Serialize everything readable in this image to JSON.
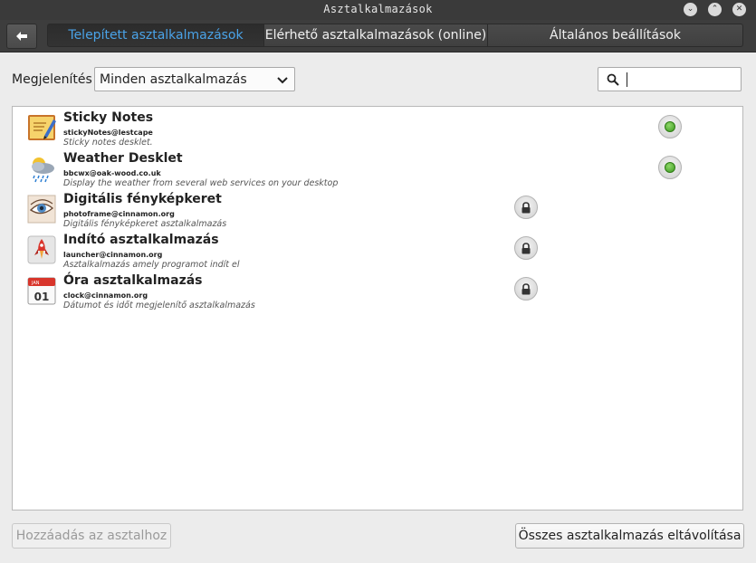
{
  "window": {
    "title": "Asztalkalmazások"
  },
  "toolbar": {
    "tabs": [
      {
        "label": "Telepített asztalkalmazások",
        "active": true
      },
      {
        "label": "Elérhető asztalkalmazások (online)",
        "active": false
      },
      {
        "label": "Általános beállítások",
        "active": false
      }
    ]
  },
  "filter": {
    "label": "Megjelenítés",
    "selected": "Minden asztalkalmazás",
    "search_value": ""
  },
  "desklets": [
    {
      "name": "Sticky Notes",
      "uuid": "stickyNotes@lestcape",
      "description": "Sticky notes desklet.",
      "status": "enabled",
      "icon": "sticky-notes-icon"
    },
    {
      "name": "Weather Desklet",
      "uuid": "bbcwx@oak-wood.co.uk",
      "description": "Display the weather from several web services on your desktop",
      "status": "enabled",
      "icon": "weather-icon"
    },
    {
      "name": "Digitális fényképkeret",
      "uuid": "photoframe@cinnamon.org",
      "description": "Digitális fényképkeret asztalkalmazás",
      "status": "locked",
      "icon": "photo-frame-icon"
    },
    {
      "name": "Indító asztalkalmazás",
      "uuid": "launcher@cinnamon.org",
      "description": "Asztalkalmazás amely programot indít el",
      "status": "locked",
      "icon": "launcher-icon"
    },
    {
      "name": "Óra asztalkalmazás",
      "uuid": "clock@cinnamon.org",
      "description": "Dátumot és időt megjelenítő asztalkalmazás",
      "status": "locked",
      "icon": "calendar-clock-icon",
      "icon_text": {
        "month": "JAN",
        "day": "01"
      }
    }
  ],
  "buttons": {
    "add": "Hozzáadás az asztalhoz",
    "remove_all": "Összes asztalkalmazás eltávolítása"
  },
  "colors": {
    "active_tab": "#4aa3e8",
    "enabled_status": "#3b9a1e"
  }
}
